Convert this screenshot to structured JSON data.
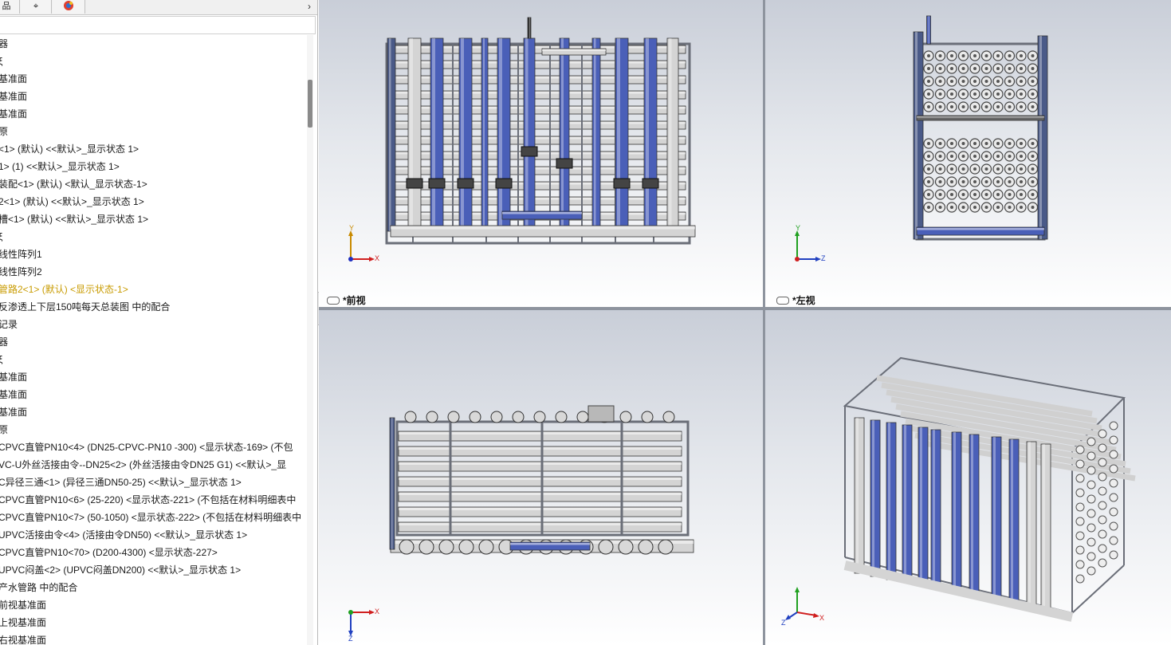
{
  "tree": {
    "tabs": [
      "品",
      "⌖",
      "●"
    ],
    "expand_glyph": "›",
    "items": [
      "器",
      "ξ",
      "基准面",
      "基准面",
      "基准面",
      "原",
      "<1> (默认) <<默认>_显示状态 1>",
      "1> (1) <<默认>_显示状态 1>",
      "装配<1> (默认) <默认_显示状态-1>",
      "2<1> (默认) <<默认>_显示状态 1>",
      "槽<1> (默认) <<默认>_显示状态 1>",
      "ξ",
      "线性阵列1",
      "线性阵列2",
      "管路2<1> (默认) <显示状态-1>",
      "反渗透上下层150吨每天总装图 中的配合",
      "记录",
      "器",
      "ξ",
      "基准面",
      "基准面",
      "基准面",
      "原",
      "CPVC直管PN10<4> (DN25-CPVC-PN10 -300) <显示状态-169> (不包",
      "VC-U外丝活接由令--DN25<2> (外丝活接由令DN25 G1) <<默认>_显",
      "C异径三通<1> (异径三通DN50-25) <<默认>_显示状态 1>",
      "CPVC直管PN10<6> (25-220) <显示状态-221> (不包括在材料明细表中",
      "CPVC直管PN10<7> (50-1050) <显示状态-222> (不包括在材料明细表中",
      "UPVC活接由令<4> (活接由令DN50) <<默认>_显示状态 1>",
      "CPVC直管PN10<70> (D200-4300) <显示状态-227>",
      "UPVC闷盖<2> (UPVC闷盖DN200) <<默认>_显示状态 1>",
      "产水管路 中的配合",
      "前视基准面",
      "上视基准面",
      "右视基准面"
    ],
    "highlight_index": 14
  },
  "viewports": {
    "front_label": "*前视",
    "left_label": "*左视"
  },
  "triad": {
    "x": "X",
    "y": "Y",
    "z": "Z"
  },
  "colors": {
    "pipe_blue": "#4a5fb8",
    "pipe_grey": "#d4d4d4",
    "frame": "#6a6e78",
    "highlight": "#c89b00"
  }
}
